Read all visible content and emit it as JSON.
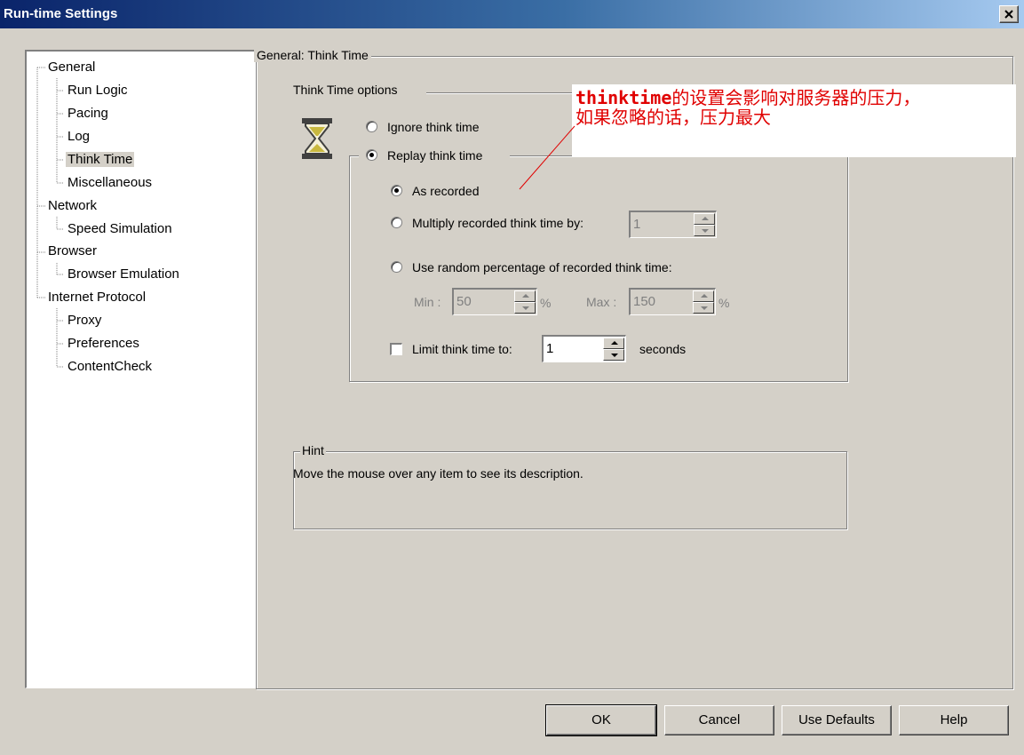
{
  "window": {
    "title": "Run-time Settings"
  },
  "tree": {
    "items": [
      {
        "label": "General"
      },
      {
        "label": "Run Logic"
      },
      {
        "label": "Pacing"
      },
      {
        "label": "Log"
      },
      {
        "label": "Think Time",
        "selected": true
      },
      {
        "label": "Miscellaneous"
      },
      {
        "label": "Network"
      },
      {
        "label": "Speed Simulation"
      },
      {
        "label": "Browser"
      },
      {
        "label": "Browser Emulation"
      },
      {
        "label": "Internet Protocol"
      },
      {
        "label": "Proxy"
      },
      {
        "label": "Preferences"
      },
      {
        "label": "ContentCheck"
      }
    ]
  },
  "panel": {
    "title": "General: Think Time",
    "options_title": "Think Time options",
    "ignore_label": "Ignore think time",
    "replay_label": "Replay think time",
    "as_recorded_label": "As recorded",
    "multiply_label": "Multiply recorded think time by:",
    "multiply_value": "1",
    "random_label": "Use random percentage of recorded think time:",
    "min_label": "Min :",
    "min_value": "50",
    "max_label": "Max :",
    "max_value": "150",
    "percent": "%",
    "limit_label": "Limit think time to:",
    "limit_value": "1",
    "seconds_label": "seconds",
    "selected_option": "replay",
    "replay_mode": "as_recorded",
    "limit_checked": false
  },
  "hint": {
    "title": "Hint",
    "text": "Move the mouse over any item to see its description."
  },
  "buttons": {
    "ok": "OK",
    "cancel": "Cancel",
    "defaults": "Use Defaults",
    "help": "Help"
  },
  "annotation": {
    "keyword": "thinktime",
    "line1_rest": "的设置会影响对服务器的压力，",
    "line2": "如果忽略的话，压力最大",
    "color": "#e00000"
  }
}
